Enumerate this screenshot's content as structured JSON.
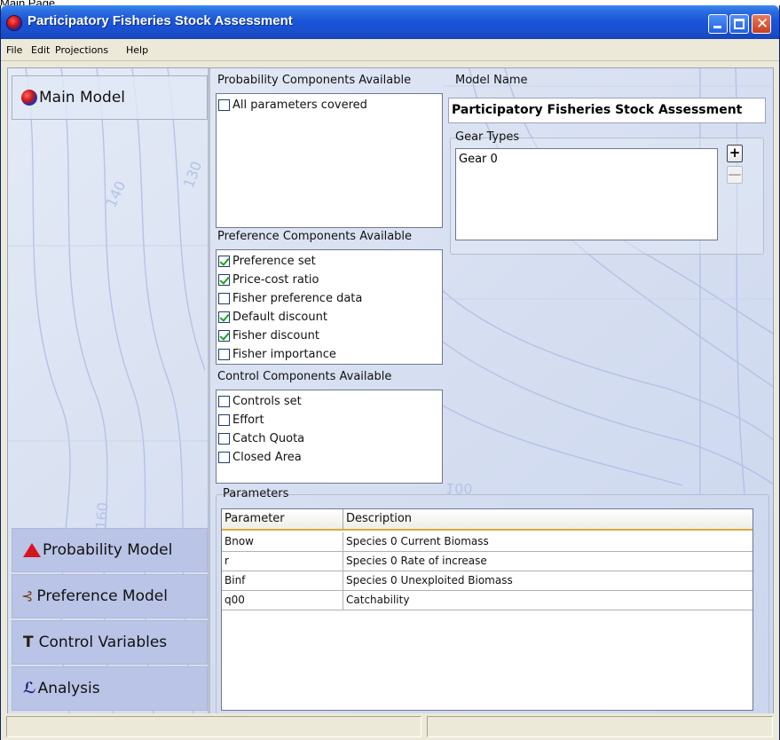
{
  "caption": "Main Page",
  "window": {
    "title": "Participatory Fisheries Stock Assessment"
  },
  "menu": [
    {
      "label": "File"
    },
    {
      "label": "Edit"
    },
    {
      "label": "Projections"
    },
    {
      "label": "Help"
    }
  ],
  "nav": {
    "main": {
      "label": "Main Model",
      "icon": "globe-icon"
    },
    "items": [
      {
        "label": "Probability Model",
        "icon": "mountain-icon"
      },
      {
        "label": "Preference Model",
        "icon": "tree-icon"
      },
      {
        "label": "Control Variables",
        "icon": "t-icon"
      },
      {
        "label": "Analysis",
        "icon": "chart-icon"
      }
    ]
  },
  "probability": {
    "label": "Probability Components Available",
    "items": [
      {
        "label": "All parameters covered",
        "checked": false
      }
    ]
  },
  "preference": {
    "label": "Preference Components Available",
    "items": [
      {
        "label": "Preference set",
        "checked": true
      },
      {
        "label": "Price-cost ratio",
        "checked": true
      },
      {
        "label": "Fisher preference data",
        "checked": false
      },
      {
        "label": "Default discount",
        "checked": true
      },
      {
        "label": "Fisher discount",
        "checked": true
      },
      {
        "label": "Fisher importance",
        "checked": false
      }
    ]
  },
  "control": {
    "label": "Control Components Available",
    "items": [
      {
        "label": "Controls set",
        "checked": false
      },
      {
        "label": "Effort",
        "checked": false
      },
      {
        "label": "Catch Quota",
        "checked": false
      },
      {
        "label": "Closed Area",
        "checked": false
      }
    ]
  },
  "model": {
    "name_label": "Model Name",
    "name_value": "Participatory Fisheries Stock Assessment"
  },
  "gear": {
    "label": "Gear Types",
    "items": [
      "Gear 0"
    ],
    "add_label": "+",
    "remove_label": "—"
  },
  "parameters": {
    "label": "Parameters",
    "columns": [
      "Parameter",
      "Description"
    ],
    "rows": [
      [
        "Bnow",
        "Species 0 Current Biomass"
      ],
      [
        "r",
        "Species 0 Rate of increase"
      ],
      [
        "Binf",
        "Species 0 Unexploited Biomass"
      ],
      [
        "q00",
        "Catchability"
      ]
    ]
  },
  "background": {
    "contour_labels": [
      "140",
      "130",
      "160",
      "100"
    ]
  },
  "colors": {
    "titlebar": "#1b55d8",
    "nav_button": "#b9c4e6",
    "content_bg": "#dfe6f3",
    "check": "#21a121",
    "table_header_line": "#d9a93f"
  }
}
